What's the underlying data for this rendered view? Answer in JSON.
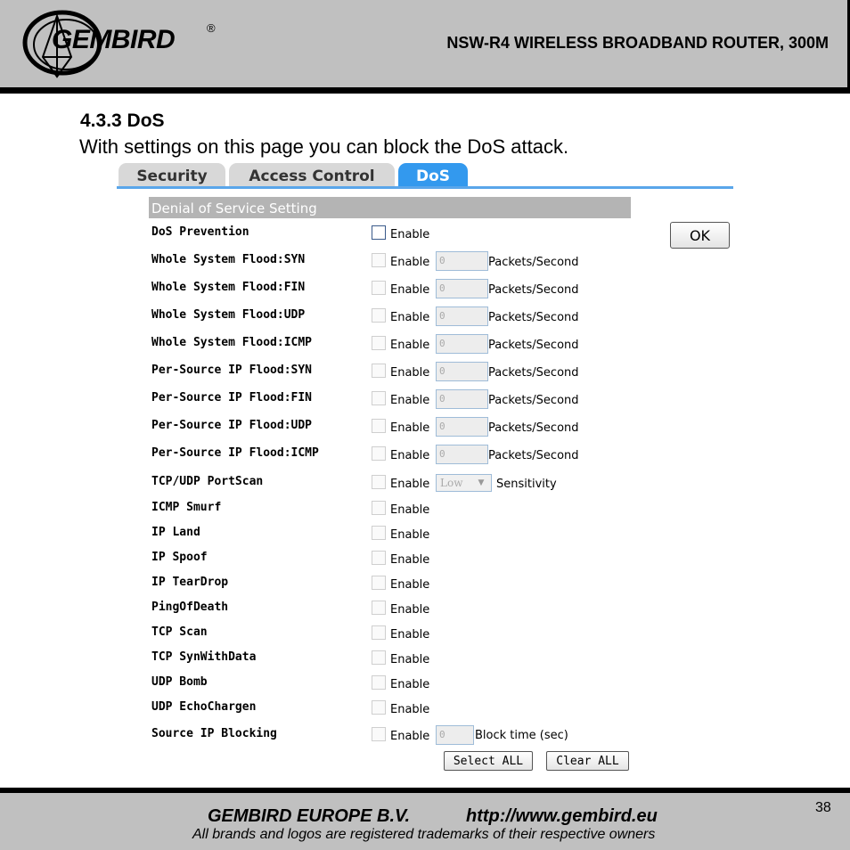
{
  "header": {
    "logo_text": "GEMBIRD",
    "logo_reg": "®",
    "title": "NSW-R4 WIRELESS BROADBAND ROUTER, 300M"
  },
  "section": {
    "heading": "4.3.3 DoS",
    "description": "With settings on this page you can block the DoS attack."
  },
  "tabs": [
    {
      "label": "Security"
    },
    {
      "label": "Access Control"
    },
    {
      "label": "DoS",
      "active": true
    }
  ],
  "panel": {
    "title": "Denial of Service Setting",
    "ok_label": "OK",
    "enable_label": "Enable",
    "packets_unit": "Packets/Second",
    "sensitivity_label": "Sensitivity",
    "block_time_label": "Block time (sec)",
    "rows": [
      {
        "label": "DoS Prevention",
        "kind": "check"
      },
      {
        "label": "Whole System Flood:SYN",
        "kind": "rate",
        "value": "0"
      },
      {
        "label": "Whole System Flood:FIN",
        "kind": "rate",
        "value": "0"
      },
      {
        "label": "Whole System Flood:UDP",
        "kind": "rate",
        "value": "0"
      },
      {
        "label": "Whole System Flood:ICMP",
        "kind": "rate",
        "value": "0"
      },
      {
        "label": "Per-Source IP Flood:SYN",
        "kind": "rate",
        "value": "0"
      },
      {
        "label": "Per-Source IP Flood:FIN",
        "kind": "rate",
        "value": "0"
      },
      {
        "label": "Per-Source IP Flood:UDP",
        "kind": "rate",
        "value": "0"
      },
      {
        "label": "Per-Source IP Flood:ICMP",
        "kind": "rate",
        "value": "0"
      },
      {
        "label": "TCP/UDP PortScan",
        "kind": "select",
        "value": "Low"
      },
      {
        "label": "ICMP Smurf",
        "kind": "check"
      },
      {
        "label": "IP Land",
        "kind": "check"
      },
      {
        "label": "IP Spoof",
        "kind": "check"
      },
      {
        "label": "IP TearDrop",
        "kind": "check"
      },
      {
        "label": "PingOfDeath",
        "kind": "check"
      },
      {
        "label": "TCP Scan",
        "kind": "check"
      },
      {
        "label": "TCP SynWithData",
        "kind": "check"
      },
      {
        "label": "UDP Bomb",
        "kind": "check"
      },
      {
        "label": "UDP EchoChargen",
        "kind": "check"
      },
      {
        "label": "Source IP Blocking",
        "kind": "block",
        "value": "0"
      }
    ],
    "select_all_label": "Select ALL",
    "clear_all_label": "Clear ALL"
  },
  "footer": {
    "company": "GEMBIRD EUROPE B.V.",
    "url": "http://www.gembird.eu",
    "note": "All brands and logos are registered trademarks of their respective owners",
    "page_number": "38"
  }
}
